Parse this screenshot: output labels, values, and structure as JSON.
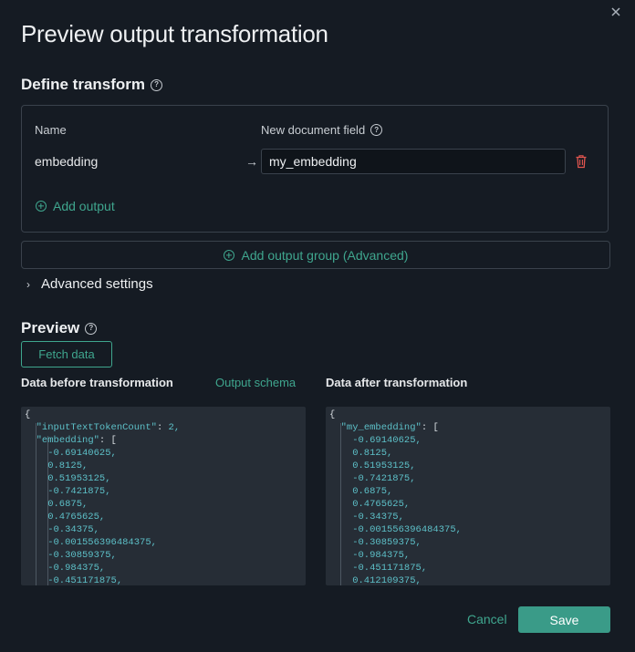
{
  "dialog": {
    "title": "Preview output transformation",
    "close_icon": "close-icon"
  },
  "define_transform": {
    "heading": "Define transform",
    "help_icon": "question-circle-icon",
    "columns": {
      "name": "Name",
      "new_field": "New document field"
    },
    "row": {
      "name": "embedding",
      "arrow": "→",
      "new_field_value": "my_embedding",
      "delete_icon": "trash-icon"
    },
    "add_output_label": "Add output",
    "add_group_label": "Add output group (Advanced)"
  },
  "advanced": {
    "label": "Advanced settings",
    "chevron": "›"
  },
  "preview": {
    "heading": "Preview",
    "fetch_label": "Fetch data",
    "before_label": "Data before transformation",
    "schema_link": "Output schema",
    "after_label": "Data after transformation",
    "before_lines": [
      "{",
      "  \"inputTextTokenCount\": 2,",
      "  \"embedding\": [",
      "    -0.69140625,",
      "    0.8125,",
      "    0.51953125,",
      "    -0.7421875,",
      "    0.6875,",
      "    0.4765625,",
      "    -0.34375,",
      "    -0.001556396484375,",
      "    -0.30859375,",
      "    -0.984375,",
      "    -0.451171875,"
    ],
    "after_lines": [
      "{",
      "  \"my_embedding\": [",
      "    -0.69140625,",
      "    0.8125,",
      "    0.51953125,",
      "    -0.7421875,",
      "    0.6875,",
      "    0.4765625,",
      "    -0.34375,",
      "    -0.001556396484375,",
      "    -0.30859375,",
      "    -0.984375,",
      "    -0.451171875,",
      "    0.412109375,"
    ]
  },
  "footer": {
    "cancel_label": "Cancel",
    "save_label": "Save"
  },
  "colors": {
    "accent": "#3fa68e",
    "save_bg": "#3a9b88",
    "delete": "#e0554f",
    "background": "#151b23"
  }
}
